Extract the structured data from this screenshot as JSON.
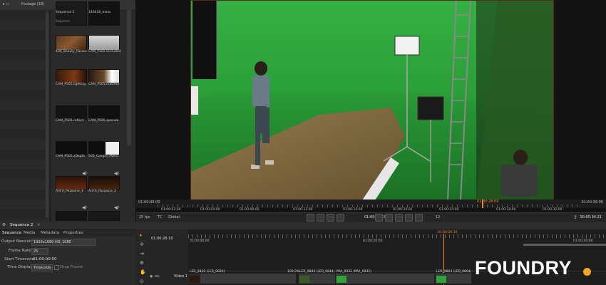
{
  "bin": {
    "folder_label": "Footage (18)",
    "items": [
      {
        "label": "Sequence 2",
        "sub": "Sequence"
      },
      {
        "label": "140416_mass",
        "sub": ""
      },
      {
        "label": "400_Beauty_Passes",
        "sub": ""
      },
      {
        "label": "CAM_P505.0ccluded",
        "sub": ""
      },
      {
        "label": "CAM_P505.lighting",
        "sub": ""
      },
      {
        "label": "CAM_P505.matteDI",
        "sub": ""
      },
      {
        "label": "CAM_P505.reflect",
        "sub": ""
      },
      {
        "label": "CAM_P505.specula",
        "sub": ""
      },
      {
        "label": "CAM_P505.zDepth",
        "sub": ""
      },
      {
        "label": "505_Compo_Alpha",
        "sub": ""
      },
      {
        "label": "AriFX_Pozzaine_1",
        "sub": ""
      },
      {
        "label": "AriFX_Pozzaine_2",
        "sub": ""
      }
    ]
  },
  "viewer": {
    "ruler_start": "01:00:00:00",
    "ruler_end": "01:00:34:00",
    "ruler_marks": [
      "01:00:02:00",
      "01:00:04:00",
      "01:00:08:00",
      "01:00:12:00",
      "01:00:16:00",
      "01:00:20:00",
      "01:00:24:00",
      "01:00:28:00",
      "01:00:32:00"
    ],
    "playhead_time": "01:00:28:00",
    "fps": "25 fps",
    "tc_label": "TC",
    "global_label": "Global",
    "current_timecode": "01:00:26:19",
    "frame_step": "12",
    "duration": "00:00:34:21"
  },
  "tabs": {
    "sequence_tab": "Sequence 2",
    "panel_tabs": [
      "Sequence",
      "Media",
      "Metadata",
      "Properties"
    ]
  },
  "properties": {
    "output_resolution_label": "Output Resolution:",
    "output_resolution_value": "1920x1080 HD_1080",
    "frame_rate_label": "Frame Rate:",
    "frame_rate_value": "25",
    "start_timecode_label": "Start Timecode:",
    "start_timecode_value": "01:00:00:00",
    "time_display_label": "Time Display:",
    "time_display_value": "Timecode",
    "drop_frame_label": "Drop Frame"
  },
  "timeline": {
    "current_time": "01:00:26:10",
    "ruler_marks": [
      "01:00:00:00",
      "01:00:20:00",
      "01:00:40:00"
    ],
    "playhead_label": "01:00:26:10",
    "track_name": "Video 1",
    "clips": [
      {
        "label": "LER_9820 (LER_9820)"
      },
      {
        "label": "LER_9844 (LER_9844)"
      },
      {
        "label": "MVI_0932 (MVI_0932)"
      },
      {
        "label": "LER_9864 (LER_9864)"
      }
    ],
    "speed_label": "100.0%"
  },
  "logo": {
    "text": "FOUNDRY",
    "accent": "#f5a623"
  },
  "colors": {
    "green_screen": "#2fa33a",
    "playhead": "#f08a24",
    "panel": "#2a2a2a"
  }
}
